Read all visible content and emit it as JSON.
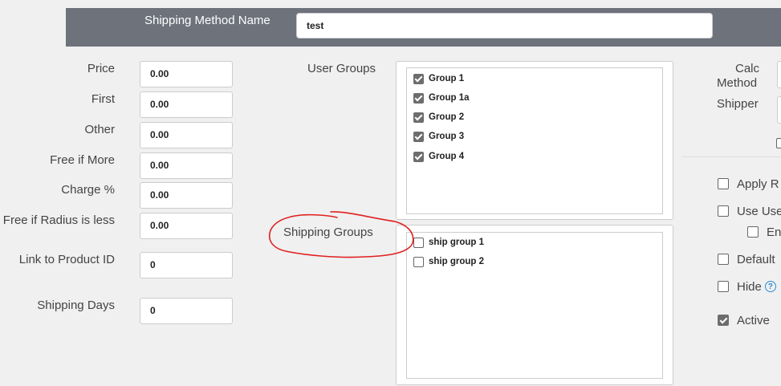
{
  "header": {
    "label": "Shipping Method Name",
    "name_value": "test"
  },
  "fields": [
    {
      "label": "Price",
      "value": "0.00"
    },
    {
      "label": "First",
      "value": "0.00"
    },
    {
      "label": "Other",
      "value": "0.00"
    },
    {
      "label": "Free if More",
      "value": "0.00"
    },
    {
      "label": "Charge %",
      "value": "0.00"
    },
    {
      "label": "Free if Radius is less",
      "value": "0.00"
    },
    {
      "label": "Link to Product ID",
      "value": "0"
    },
    {
      "label": "Shipping Days",
      "value": "0"
    }
  ],
  "user_groups": {
    "label": "User Groups",
    "items": [
      {
        "label": "Group 1",
        "checked": true
      },
      {
        "label": "Group 1a",
        "checked": true
      },
      {
        "label": "Group 2",
        "checked": true
      },
      {
        "label": "Group 3",
        "checked": true
      },
      {
        "label": "Group 4",
        "checked": true
      }
    ]
  },
  "shipping_groups": {
    "label": "Shipping Groups",
    "items": [
      {
        "label": "ship group 1",
        "checked": false
      },
      {
        "label": "ship group 2",
        "checked": false
      }
    ]
  },
  "right_column": {
    "calc_method_label_1": "Calc",
    "calc_method_label_2": "Method",
    "shipper_label": "Shipper",
    "apply_label": "Apply R",
    "use_user_label": "Use Use",
    "en_label": "En",
    "default_label": "Default",
    "hide_label": "Hide",
    "help_icon": "?",
    "active_label": "Active",
    "apply_checked": false,
    "use_user_checked": false,
    "en_checked": false,
    "default_checked": false,
    "hide_checked": false,
    "active_checked": true
  },
  "colors": {
    "header_bg": "#6d727b",
    "page_bg": "#f0f0f0",
    "annotation": "#e02020",
    "help_blue": "#2a8ad4"
  }
}
